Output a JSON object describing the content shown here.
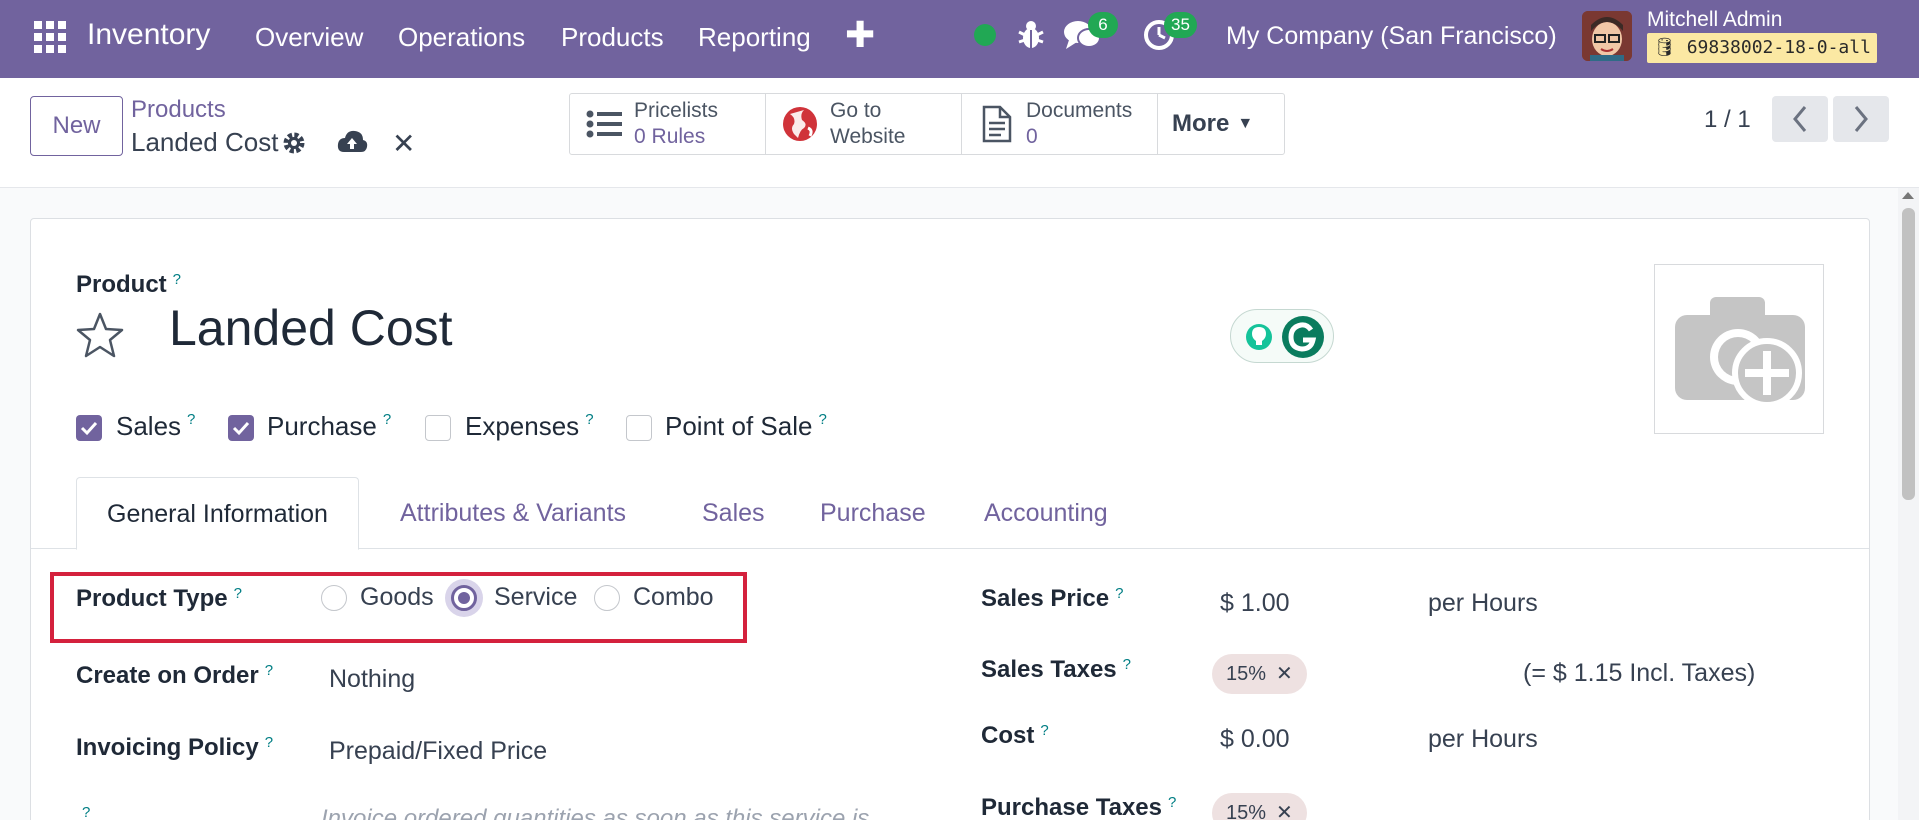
{
  "navbar": {
    "app_name": "Inventory",
    "menu": [
      "Overview",
      "Operations",
      "Products",
      "Reporting"
    ],
    "plus": "✚",
    "messages_count": "6",
    "activities_count": "35",
    "company": "My Company (San Francisco)",
    "user_name": "Mitchell Admin",
    "database": "69838002-18-0-all"
  },
  "control_panel": {
    "new_label": "New",
    "breadcrumb": "Products",
    "record_name": "Landed Cost",
    "smart_buttons": [
      {
        "line1": "Pricelists",
        "line2_num": "0",
        "line2_text": "Rules"
      },
      {
        "line1": "Go to",
        "line2_num": "",
        "line2_text": "Website"
      },
      {
        "line1": "Documents",
        "line2_num": "0",
        "line2_text": ""
      }
    ],
    "more_label": "More",
    "pager": "1 / 1"
  },
  "form": {
    "product_label": "Product",
    "product_name": "Landed Cost",
    "checkboxes": [
      {
        "label": "Sales",
        "checked": true
      },
      {
        "label": "Purchase",
        "checked": true
      },
      {
        "label": "Expenses",
        "checked": false
      },
      {
        "label": "Point of Sale",
        "checked": false
      }
    ],
    "tabs": [
      "General Information",
      "Attributes & Variants",
      "Sales",
      "Purchase",
      "Accounting"
    ],
    "product_type_label": "Product Type",
    "product_type_options": [
      "Goods",
      "Service",
      "Combo"
    ],
    "product_type_selected": "Service",
    "create_on_order_label": "Create on Order",
    "create_on_order_value": "Nothing",
    "invoicing_policy_label": "Invoicing Policy",
    "invoicing_policy_value": "Prepaid/Fixed Price",
    "invoicing_note": "Invoice ordered quantities as soon as this service is",
    "sales_price_label": "Sales Price",
    "sales_price_value": "$ 1.00",
    "sales_price_unit": "per  Hours",
    "sales_taxes_label": "Sales Taxes",
    "sales_tax_tag": "15%",
    "sales_tax_incl": "(= $ 1.15 Incl. Taxes)",
    "cost_label": "Cost",
    "cost_value": "$ 0.00",
    "cost_unit": "per Hours",
    "purchase_taxes_label": "Purchase Taxes",
    "purchase_tax_tag": "15%",
    "help": "?"
  },
  "colors": {
    "brand": "#71639e",
    "status_online": "#21a854",
    "highlight": "#d4213d",
    "help": "#017e84"
  }
}
